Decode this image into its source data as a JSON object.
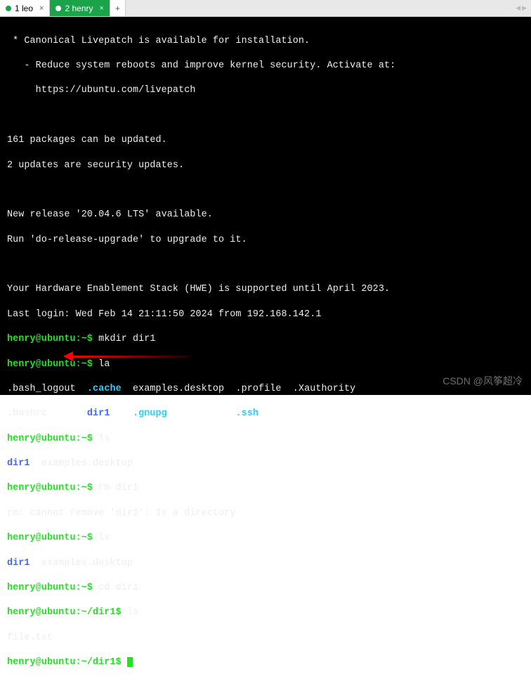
{
  "tabs": [
    {
      "label": "1 leo",
      "active": false
    },
    {
      "label": "2 henry",
      "active": true
    }
  ],
  "motd": {
    "livepatch": " * Canonical Livepatch is available for installation.",
    "reduce": "   - Reduce system reboots and improve kernel security. Activate at:",
    "url": "     https://ubuntu.com/livepatch"
  },
  "updates": {
    "pkg": "161 packages can be updated.",
    "sec": "2 updates are security updates."
  },
  "release": {
    "avail": "New release '20.04.6 LTS' available.",
    "run": "Run 'do-release-upgrade' to upgrade to it."
  },
  "hwe": "Your Hardware Enablement Stack (HWE) is supported until April 2023.",
  "login": "Last login: Wed Feb 14 21:11:50 2024 from 192.168.142.1",
  "prompt_home": "henry@ubuntu:~$",
  "prompt_dir1": "henry@ubuntu:~/dir1$",
  "cmd": {
    "mkdir": " mkdir dir1",
    "la": " la",
    "ls": " ls",
    "rm": " rm dir1",
    "cd": " cd dir1",
    "sp": " "
  },
  "la": {
    "r1a": ".bash_logout  ",
    "r1b": ".cache",
    "r1c": "  examples.desktop  .profile  .Xauthority",
    "r2a": ".bashrc       ",
    "r2b": "dir1",
    "r2c": "    ",
    "r2d": ".gnupg",
    "r2e": "            ",
    "r2f": ".ssh"
  },
  "ls1": {
    "a": "dir1",
    "b": "  examples.desktop"
  },
  "rm_err": "rm: cannot remove 'dir1': Is a directory",
  "file": "file.txt",
  "watermark": "CSDN @风筝超冷"
}
